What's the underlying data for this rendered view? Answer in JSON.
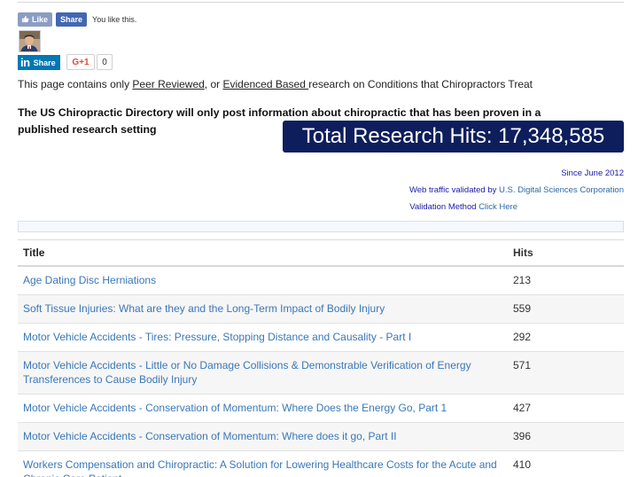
{
  "social": {
    "like_label": "Like",
    "share_label": "Share",
    "like_status": "You like this.",
    "linkedin_logo": "in",
    "linkedin_label": "Share",
    "gplus_label": "G+1",
    "gplus_count": "0"
  },
  "intro": {
    "prefix": "This page contains only ",
    "link1": "Peer Reviewed",
    "middle": ", or ",
    "link2": "Evidenced Based ",
    "suffix": "research on Conditions that Chiropractors Treat"
  },
  "headline": "The US Chiropractic Directory will only post information about chiropractic that has been proven in a published research setting",
  "hits_banner": "Total Research Hits: 17,348,585",
  "side": {
    "since": "Since June 2012",
    "validated_text": "Web traffic validated by ",
    "validated_link": "U.S. Digital Sciences Corporation",
    "method_text": "Validation Method ",
    "method_link": "Click Here"
  },
  "table": {
    "headers": [
      "Title",
      "Hits"
    ],
    "rows": [
      {
        "title": "Age Dating Disc Herniations",
        "hits": "213"
      },
      {
        "title": "Soft Tissue Injuries: What are they and the Long-Term Impact of Bodily Injury",
        "hits": "559"
      },
      {
        "title": "Motor Vehicle Accidents - Tires: Pressure, Stopping Distance and Causality - Part I",
        "hits": "292"
      },
      {
        "title": "Motor Vehicle Accidents - Little or No Damage Collisions & Demonstrable Verification of Energy Transferences to Cause Bodily Injury",
        "hits": "571"
      },
      {
        "title": "Motor Vehicle Accidents - Conservation of Momentum: Where Does the Energy Go, Part 1",
        "hits": "427"
      },
      {
        "title": "Motor Vehicle Accidents - Conservation of Momentum: Where does it go, Part II",
        "hits": "396"
      },
      {
        "title": "Workers Compensation and Chiropractic: A Solution for Lowering Healthcare Costs for the Acute and Chronic Care Patient",
        "hits": "410"
      }
    ]
  },
  "colors": {
    "banner_bg": "#0e1e5c",
    "link_blue": "#3a77b8",
    "facebook": "#4267b2",
    "linkedin": "#0077b5"
  }
}
